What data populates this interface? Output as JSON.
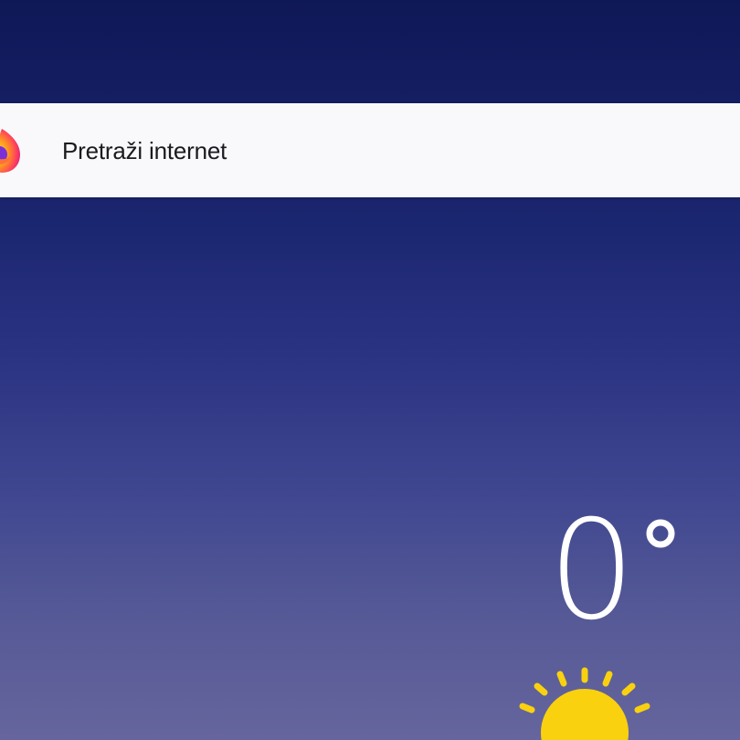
{
  "search": {
    "label": "Pretraži internet",
    "icon": "firefox-icon"
  },
  "weather": {
    "temperature": "0",
    "unit_symbol": "°",
    "condition_icon": "sun-icon",
    "sun_color": "#f9d10f"
  },
  "colors": {
    "background_top": "#0f1857",
    "background_bottom": "#66659d",
    "search_bar": "#f9f9fb",
    "text": "#1a1a1f"
  }
}
